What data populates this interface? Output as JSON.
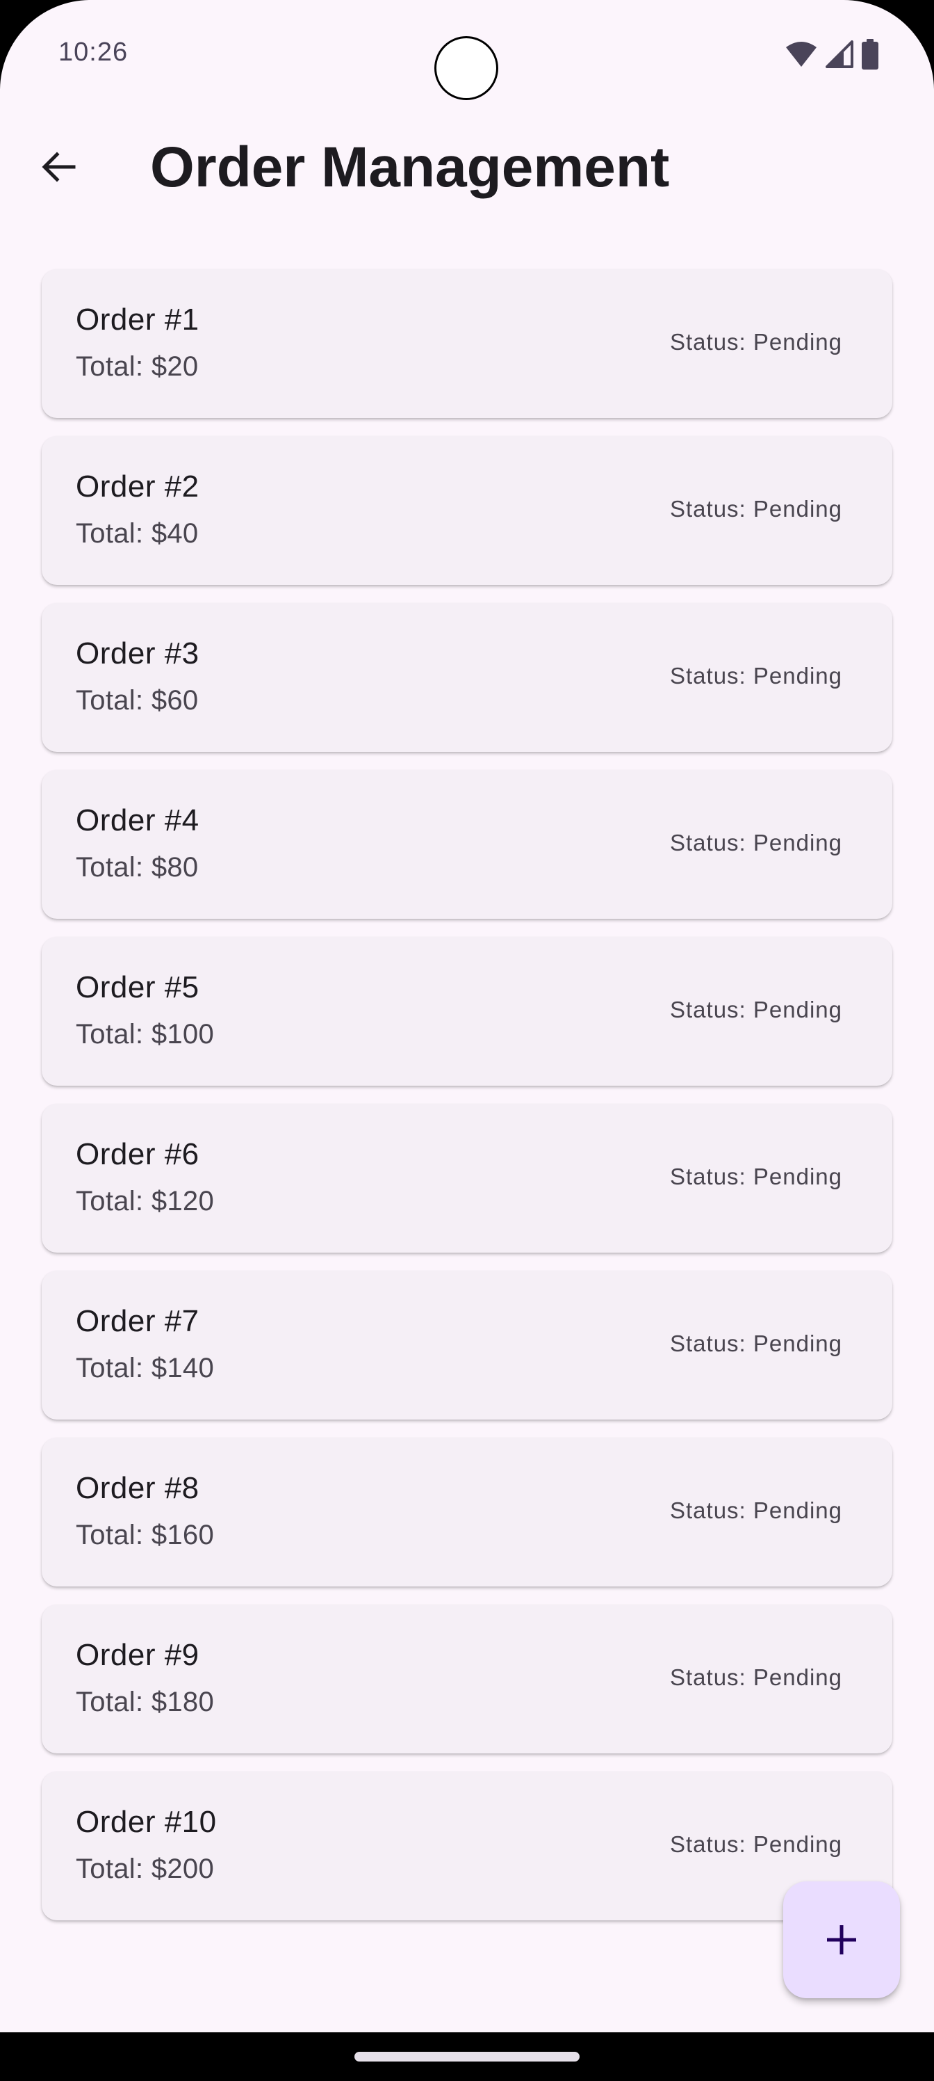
{
  "status_bar": {
    "time": "10:26",
    "icons": [
      "wifi-icon",
      "cellular-signal-icon",
      "battery-icon"
    ]
  },
  "app_bar": {
    "back_icon": "arrow-back-icon",
    "title": "Order Management"
  },
  "orders": [
    {
      "title": "Order #1",
      "total": "Total: $20",
      "status": "Status: Pending"
    },
    {
      "title": "Order #2",
      "total": "Total: $40",
      "status": "Status: Pending"
    },
    {
      "title": "Order #3",
      "total": "Total: $60",
      "status": "Status: Pending"
    },
    {
      "title": "Order #4",
      "total": "Total: $80",
      "status": "Status: Pending"
    },
    {
      "title": "Order #5",
      "total": "Total: $100",
      "status": "Status: Pending"
    },
    {
      "title": "Order #6",
      "total": "Total: $120",
      "status": "Status: Pending"
    },
    {
      "title": "Order #7",
      "total": "Total: $140",
      "status": "Status: Pending"
    },
    {
      "title": "Order #8",
      "total": "Total: $160",
      "status": "Status: Pending"
    },
    {
      "title": "Order #9",
      "total": "Total: $180",
      "status": "Status: Pending"
    },
    {
      "title": "Order #10",
      "total": "Total: $200",
      "status": "Status: Pending"
    }
  ],
  "fab": {
    "icon": "add-icon"
  },
  "colors": {
    "background": "#fcf5fc",
    "card": "#f5eff6",
    "fab": "#eaddff",
    "text_primary": "#1d1b20",
    "text_secondary": "#49454f"
  }
}
